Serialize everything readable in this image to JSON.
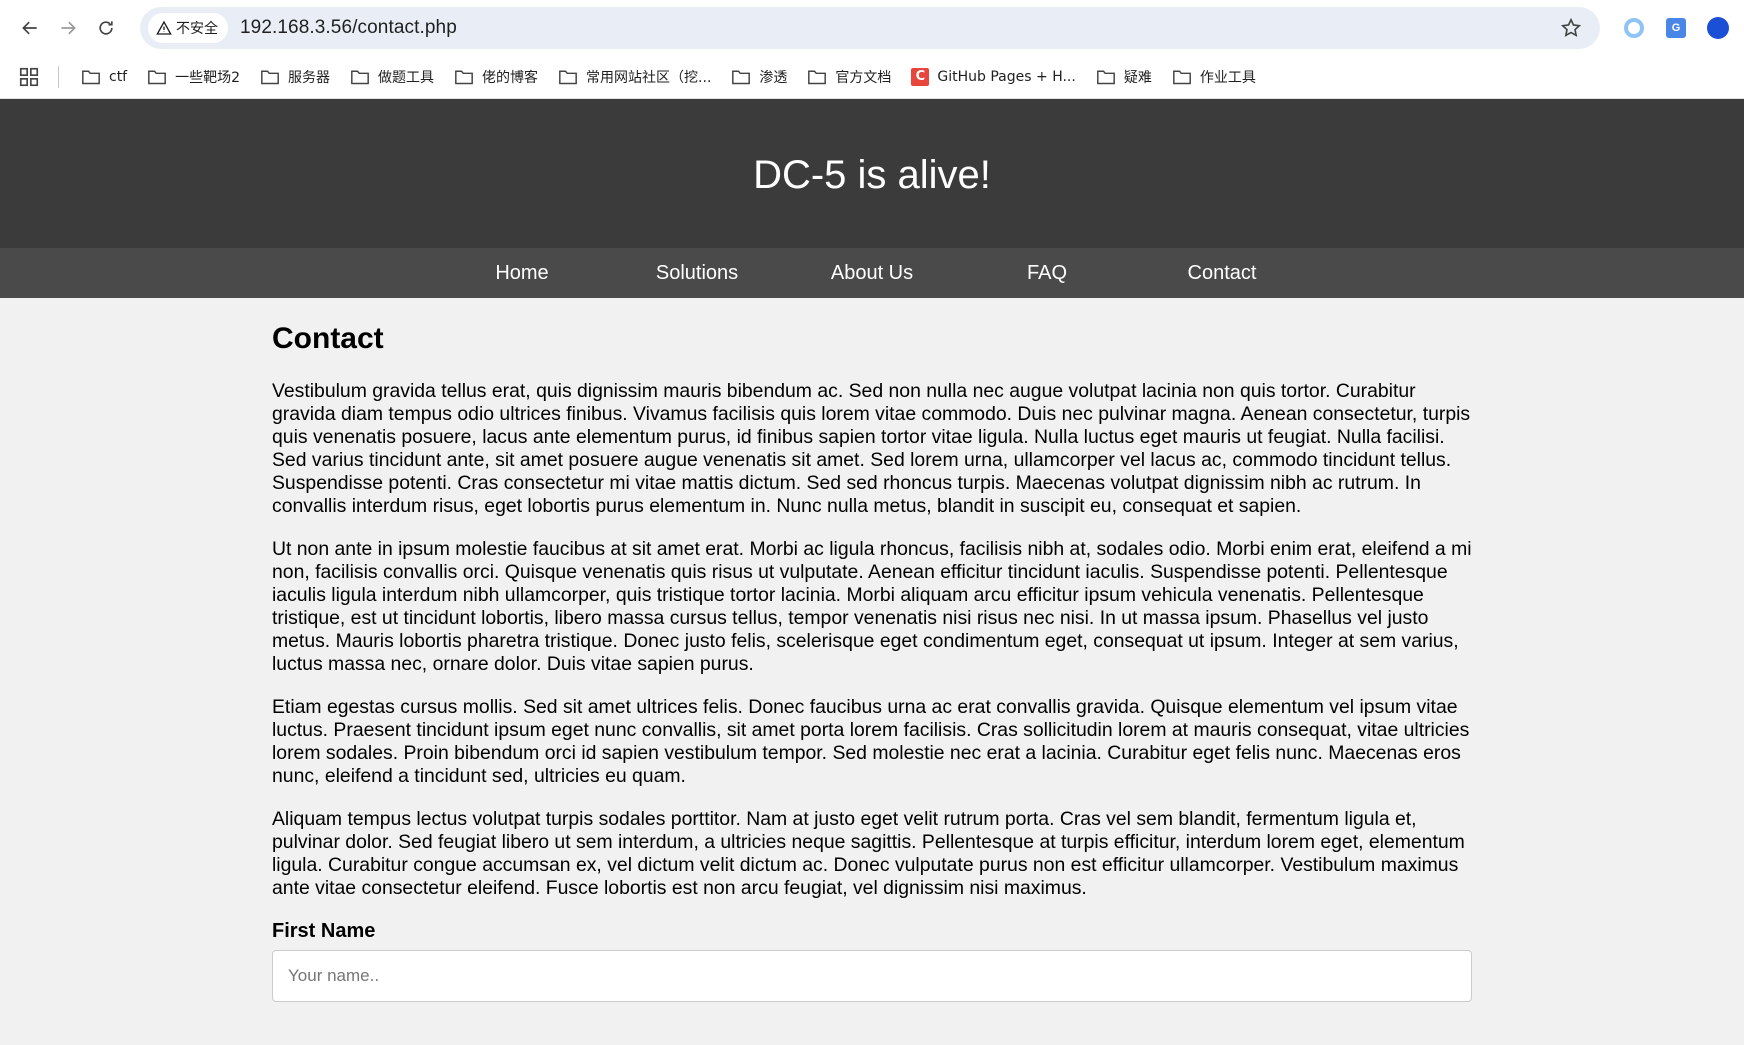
{
  "browser": {
    "security_label": "不安全",
    "url": "192.168.3.56/contact.php",
    "bookmarks": [
      {
        "label": "ctf",
        "icon": "folder-icon"
      },
      {
        "label": "一些靶场2",
        "icon": "folder-icon"
      },
      {
        "label": "服务器",
        "icon": "folder-icon"
      },
      {
        "label": "做题工具",
        "icon": "folder-icon"
      },
      {
        "label": "佬的博客",
        "icon": "folder-icon"
      },
      {
        "label": "常用网站社区（挖...",
        "icon": "folder-icon"
      },
      {
        "label": "渗透",
        "icon": "folder-icon"
      },
      {
        "label": "官方文档",
        "icon": "folder-icon"
      },
      {
        "label": "GitHub Pages + H...",
        "icon": "c-logo-icon"
      },
      {
        "label": "疑难",
        "icon": "folder-icon"
      },
      {
        "label": "作业工具",
        "icon": "folder-icon"
      }
    ]
  },
  "site": {
    "title": "DC-5 is alive!",
    "nav": [
      "Home",
      "Solutions",
      "About Us",
      "FAQ",
      "Contact"
    ]
  },
  "main": {
    "heading": "Contact",
    "paragraphs": [
      "Vestibulum gravida tellus erat, quis dignissim mauris bibendum ac. Sed non nulla nec augue volutpat lacinia non quis tortor. Curabitur gravida diam tempus odio ultrices finibus. Vivamus facilisis quis lorem vitae commodo. Duis nec pulvinar magna. Aenean consectetur, turpis quis venenatis posuere, lacus ante elementum purus, id finibus sapien tortor vitae ligula. Nulla luctus eget mauris ut feugiat. Nulla facilisi. Sed varius tincidunt ante, sit amet posuere augue venenatis sit amet. Sed lorem urna, ullamcorper vel lacus ac, commodo tincidunt tellus. Suspendisse potenti. Cras consectetur mi vitae mattis dictum. Sed sed rhoncus turpis. Maecenas volutpat dignissim nibh ac rutrum. In convallis interdum risus, eget lobortis purus elementum in. Nunc nulla metus, blandit in suscipit eu, consequat et sapien.",
      "Ut non ante in ipsum molestie faucibus at sit amet erat. Morbi ac ligula rhoncus, facilisis nibh at, sodales odio. Morbi enim erat, eleifend a mi non, facilisis convallis orci. Quisque venenatis quis risus ut vulputate. Aenean efficitur tincidunt iaculis. Suspendisse potenti. Pellentesque iaculis ligula interdum nibh ullamcorper, quis tristique tortor lacinia. Morbi aliquam arcu efficitur ipsum vehicula venenatis. Pellentesque tristique, est ut tincidunt lobortis, libero massa cursus tellus, tempor venenatis nisi risus nec nisi. In ut massa ipsum. Phasellus vel justo metus. Mauris lobortis pharetra tristique. Donec justo felis, scelerisque eget condimentum eget, consequat ut ipsum. Integer at sem varius, luctus massa nec, ornare dolor. Duis vitae sapien purus.",
      "Etiam egestas cursus mollis. Sed sit amet ultrices felis. Donec faucibus urna ac erat convallis gravida. Quisque elementum vel ipsum vitae luctus. Praesent tincidunt ipsum eget nunc convallis, sit amet porta lorem facilisis. Cras sollicitudin lorem at mauris consequat, vitae ultricies lorem sodales. Proin bibendum orci id sapien vestibulum tempor. Sed molestie nec erat a lacinia. Curabitur eget felis nunc. Maecenas eros nunc, eleifend a tincidunt sed, ultricies eu quam.",
      "Aliquam tempus lectus volutpat turpis sodales porttitor. Nam at justo eget velit rutrum porta. Cras vel sem blandit, fermentum ligula et, pulvinar dolor. Sed feugiat libero ut sem interdum, a ultricies neque sagittis. Pellentesque at turpis efficitur, interdum lorem eget, elementum ligula. Curabitur congue accumsan ex, vel dictum velit dictum ac. Donec vulputate purus non est efficitur ullamcorper. Vestibulum maximus ante vitae consectetur eleifend. Fusce lobortis est non arcu feugiat, vel dignissim nisi maximus."
    ],
    "form": {
      "first_name_label": "First Name",
      "first_name_placeholder": "Your name.."
    }
  }
}
